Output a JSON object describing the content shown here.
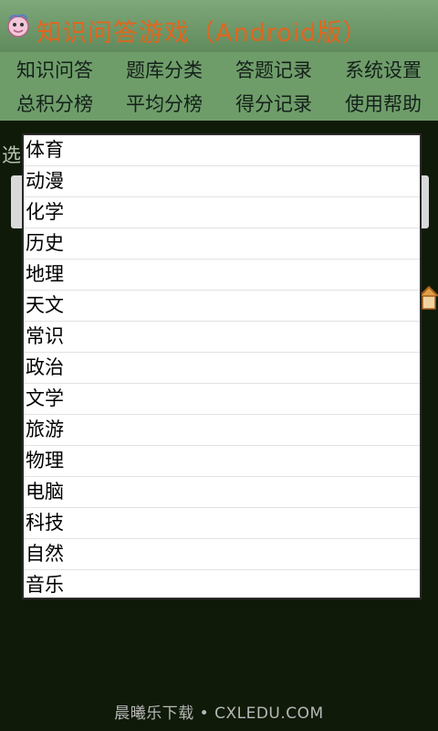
{
  "app": {
    "title": "知识问答游戏（Android版）"
  },
  "menu": {
    "row1": [
      "知识问答",
      "题库分类",
      "答题记录",
      "系统设置"
    ],
    "row2": [
      "总积分榜",
      "平均分榜",
      "得分记录",
      "使用帮助"
    ]
  },
  "background": {
    "label": "选"
  },
  "dialog": {
    "items": [
      "体育",
      "动漫",
      "化学",
      "历史",
      "地理",
      "天文",
      "常识",
      "政治",
      "文学",
      "旅游",
      "物理",
      "电脑",
      "科技",
      "自然",
      "音乐"
    ]
  },
  "footer": {
    "text": "晨曦乐下载 • CXLEDU.COM"
  },
  "colors": {
    "title_text": "#e0661e",
    "menu_bg": "#6f9d6a",
    "screen_bg": "#0f1a08"
  }
}
